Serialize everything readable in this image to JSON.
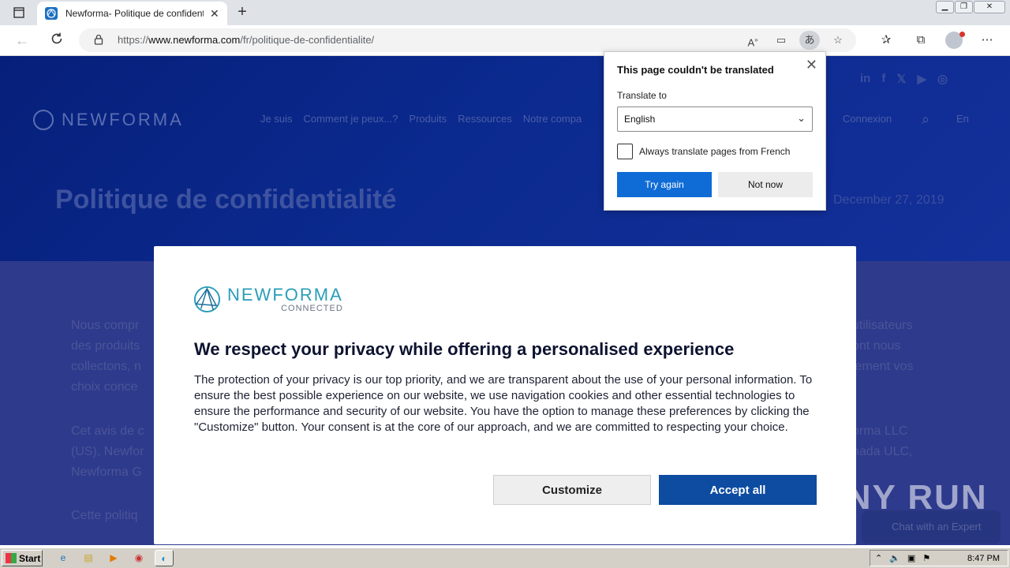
{
  "browser": {
    "tab_title": "Newforma- Politique de confidentialité",
    "tab_close": "✕",
    "new_tab": "+",
    "url_prefix": "https://",
    "url_host": "www.newforma.com",
    "url_path": "/fr/politique-de-confidentialite/"
  },
  "site": {
    "logo": "NEWFORMA",
    "nav": [
      "Je suis",
      "Comment je peux...?",
      "Produits",
      "Ressources",
      "Notre compa"
    ],
    "login": "Connexion",
    "language": "En",
    "page_title": "Politique de confidentialité",
    "date": "December 27, 2019",
    "bg_paragraph_1": [
      "Nous compr",
      "des produits",
      "collectons, n",
      "choix conce"
    ],
    "bg_paragraph_1_right": [
      "utilisateurs",
      "ont nous",
      "lement vos"
    ],
    "bg_paragraph_2": [
      "Cet avis de c",
      "(US), Newfor",
      "Newforma G"
    ],
    "bg_paragraph_2_right": [
      "orma LLC",
      "nada ULC,"
    ],
    "bg_paragraph_3": "Cette politiq",
    "chat": "Chat with an Expert"
  },
  "cookie_modal": {
    "brand": "NEWFORMA",
    "brand_sub": "CONNECTED",
    "title": "We respect your privacy while offering a personalised experience",
    "body": "The protection of your privacy is our top priority, and we are transparent about the use of your personal information. To ensure the best possible experience on our website, we use navigation cookies and other essential technologies to ensure the performance and security of our website. You have the option to manage these preferences by clicking the \"Customize\" button. Your consent is at the core of our approach, and we are committed to respecting your choice.",
    "customize": "Customize",
    "accept_all": "Accept all"
  },
  "translate_popup": {
    "title": "This page couldn't be translated",
    "close": "✕",
    "translate_to_label": "Translate to",
    "language": "English",
    "always_translate": "Always translate pages from French",
    "try_again": "Try again",
    "not_now": "Not now"
  },
  "watermark": "ANY RUN",
  "taskbar": {
    "start": "Start",
    "clock": "8:47 PM"
  }
}
